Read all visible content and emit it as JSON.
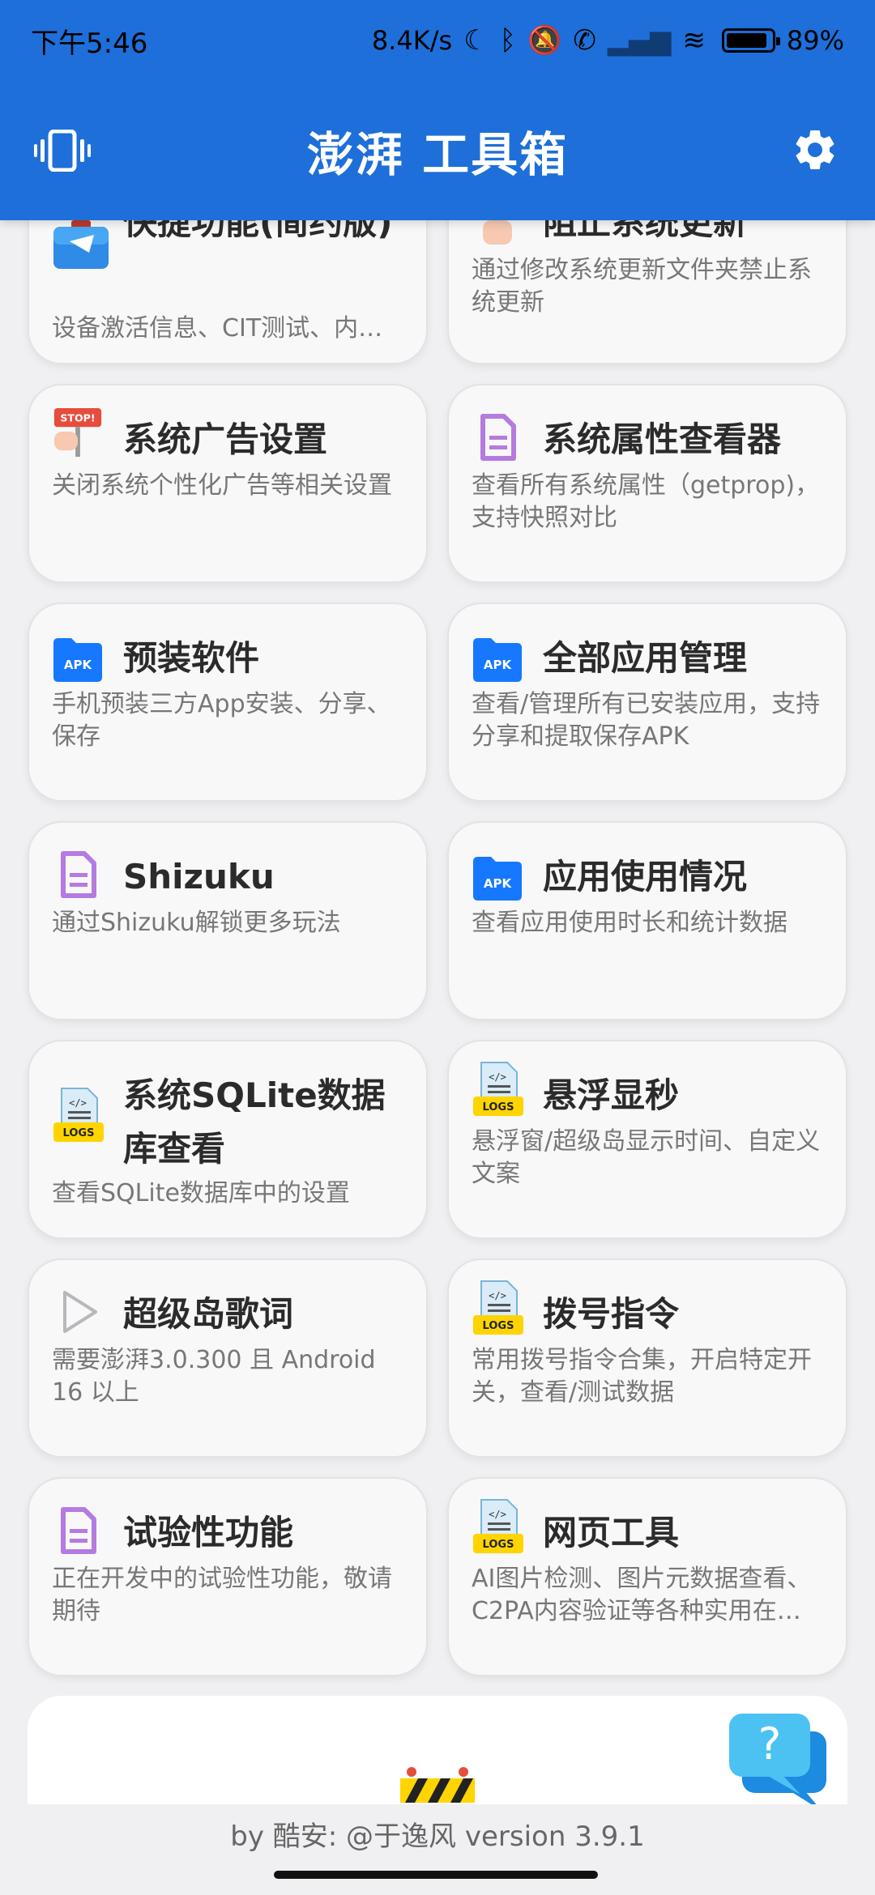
{
  "status_bar": {
    "time": "下午5:46",
    "speed": "8.4K/s",
    "battery": "89%"
  },
  "app_bar": {
    "title": "澎湃 工具箱"
  },
  "cards": [
    {
      "title": "快捷功能(简约版)",
      "desc": "设备激活信息、CIT测试、内…",
      "icon": "briefcase-icon"
    },
    {
      "title": "阻止系统更新",
      "desc": "通过修改系统更新文件夹禁止系统更新",
      "icon": "hand-icon"
    },
    {
      "title": "系统广告设置",
      "desc": "关闭系统个性化广告等相关设置",
      "icon": "stop-sign-icon"
    },
    {
      "title": "系统属性查看器",
      "desc": "查看所有系统属性（getprop)，支持快照对比",
      "icon": "document-icon"
    },
    {
      "title": "预装软件",
      "desc": "手机预装三方App安装、分享、保存",
      "icon": "apk-folder-icon"
    },
    {
      "title": "全部应用管理",
      "desc": "查看/管理所有已安装应用，支持分享和提取保存APK",
      "icon": "apk-folder-icon"
    },
    {
      "title": "Shizuku",
      "desc": "通过Shizuku解锁更多玩法",
      "icon": "document-icon"
    },
    {
      "title": "应用使用情况",
      "desc": "查看应用使用时长和统计数据",
      "icon": "apk-folder-icon"
    },
    {
      "title": "系统SQLite数据库查看",
      "desc": "查看SQLite数据库中的设置",
      "icon": "logs-icon"
    },
    {
      "title": "悬浮显秒",
      "desc": "悬浮窗/超级岛显示时间、自定义文案",
      "icon": "logs-icon"
    },
    {
      "title": "超级岛歌词",
      "desc": "需要澎湃3.0.300 且 Android 16 以上",
      "icon": "play-icon"
    },
    {
      "title": "拨号指令",
      "desc": "常用拨号指令合集，开启特定开关，查看/测试数据",
      "icon": "logs-icon"
    },
    {
      "title": "试验性功能",
      "desc": "正在开发中的试验性功能，敬请期待",
      "icon": "document-icon"
    },
    {
      "title": "网页工具",
      "desc": "AI图片检测、图片元数据查看、C2PA内容验证等各种实用在…",
      "icon": "logs-icon"
    }
  ],
  "icon_labels": {
    "apk": "APK",
    "logs": "LOGS",
    "stop": "STOP!",
    "help": "?"
  },
  "footer": {
    "text": "by 酷安: @于逸风 version 3.9.1"
  },
  "colors": {
    "header_blue": "#1e6fd9",
    "apk_blue": "#1677ff",
    "doc_purple": "#b57be0",
    "logs_yellow": "#ffd400"
  }
}
